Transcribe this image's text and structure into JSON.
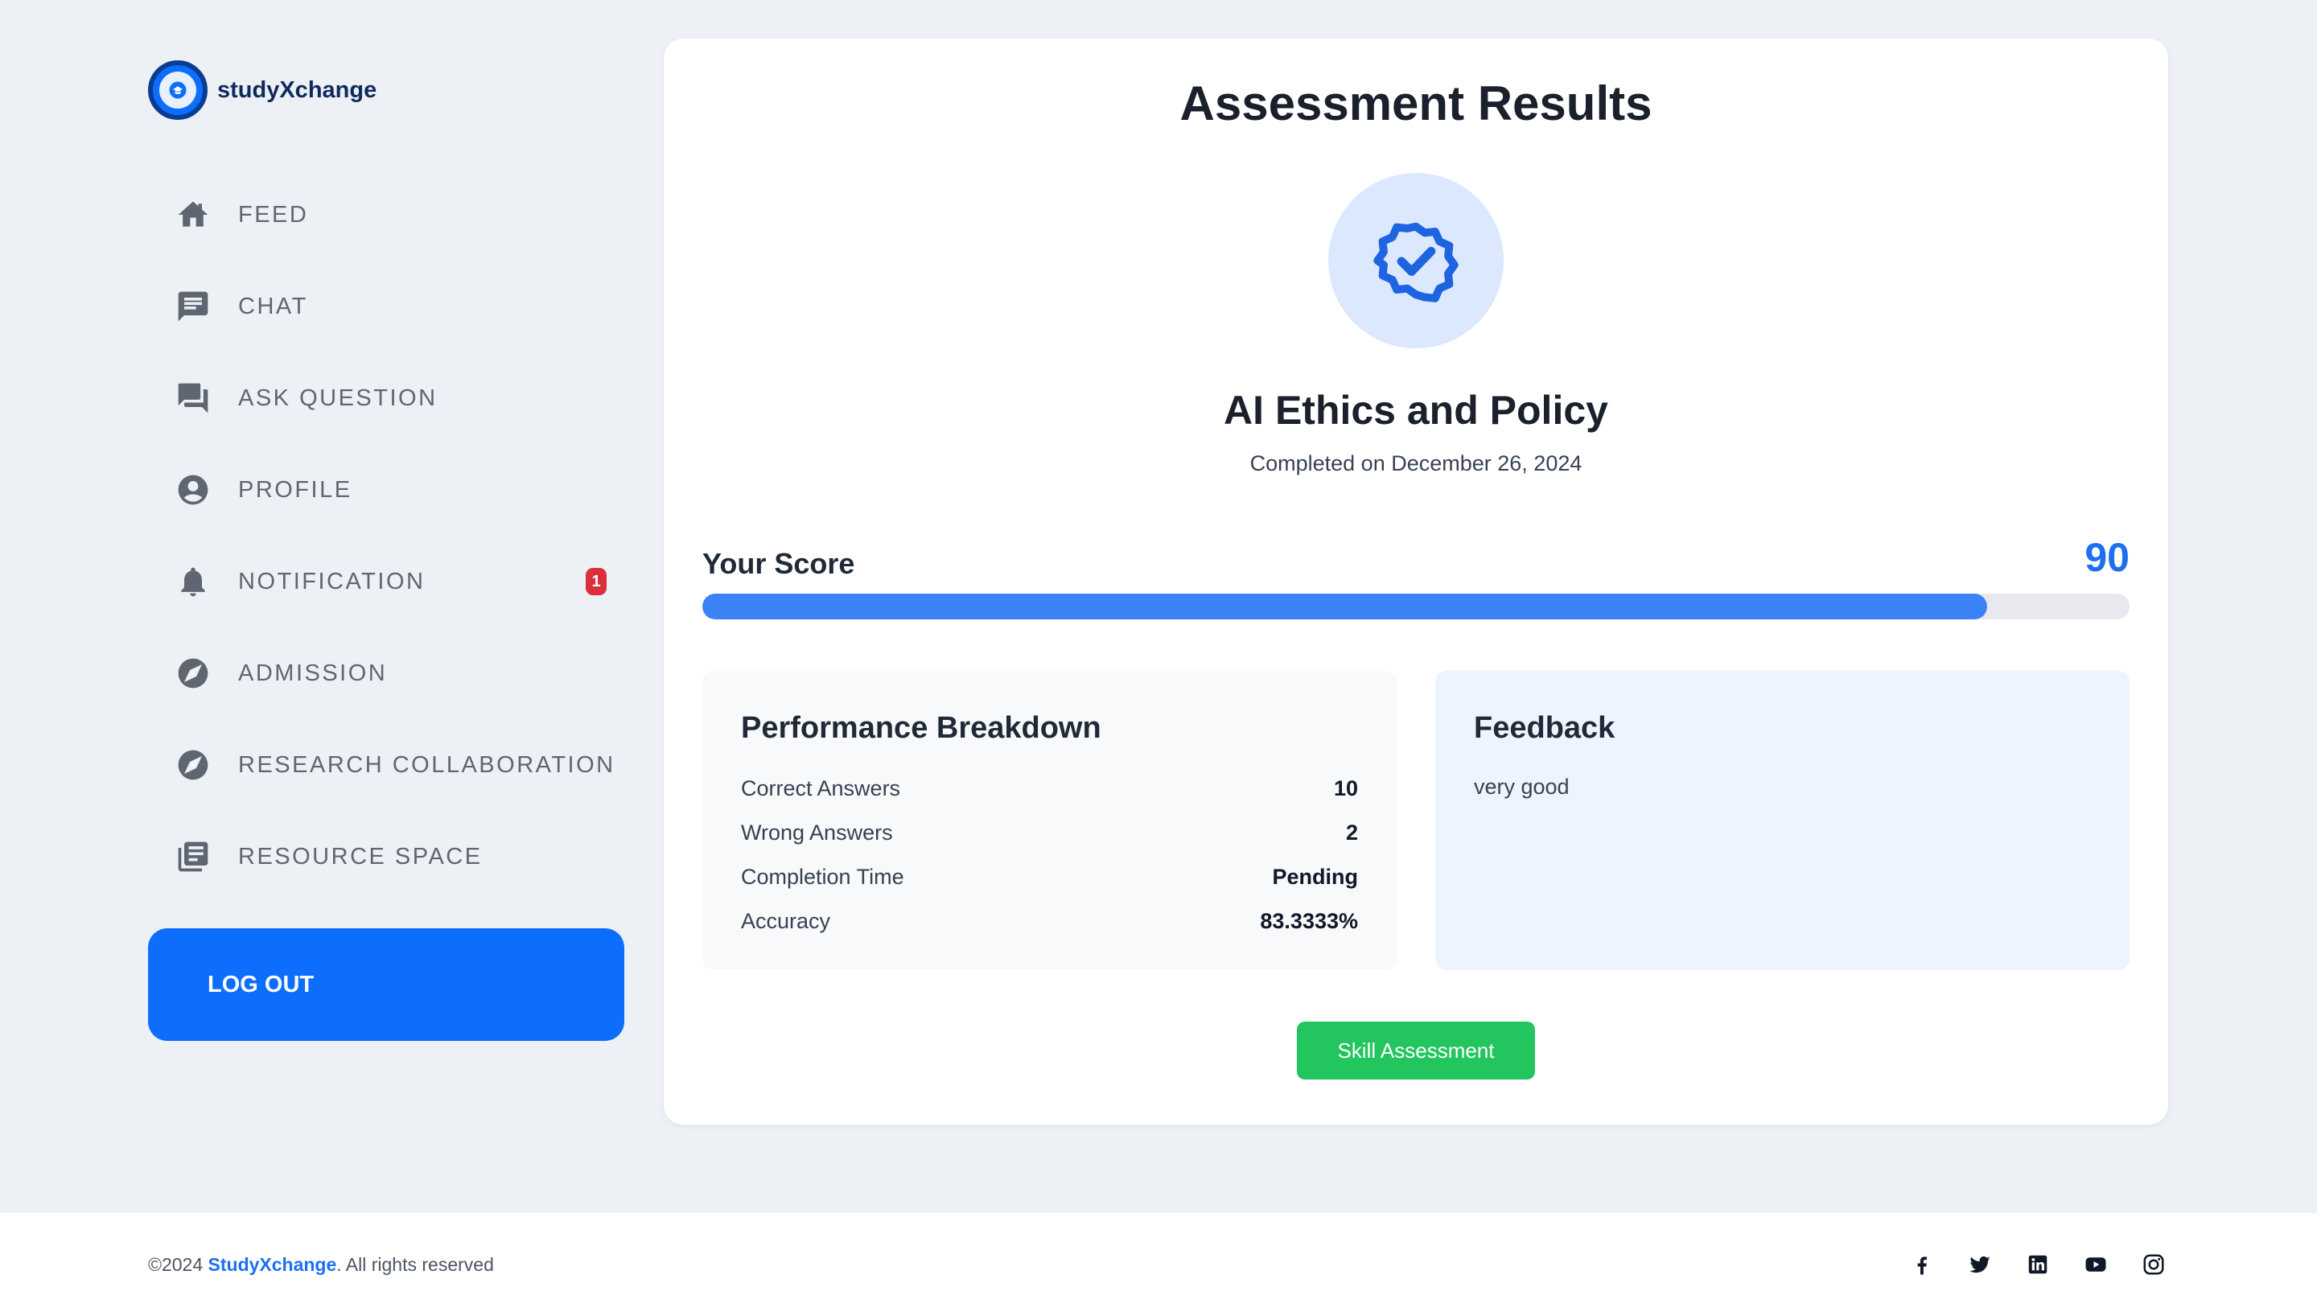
{
  "brand": {
    "name": "studyXchange"
  },
  "sidebar": {
    "items": [
      {
        "label": "FEED",
        "icon": "home-icon"
      },
      {
        "label": "CHAT",
        "icon": "chat-icon"
      },
      {
        "label": "ASK QUESTION",
        "icon": "forum-icon"
      },
      {
        "label": "PROFILE",
        "icon": "user-icon"
      },
      {
        "label": "NOTIFICATION",
        "icon": "bell-icon",
        "badge": "1"
      },
      {
        "label": "ADMISSION",
        "icon": "compass-icon"
      },
      {
        "label": "RESEARCH COLLABORATION",
        "icon": "compass-icon"
      },
      {
        "label": "RESOURCE SPACE",
        "icon": "library-icon"
      }
    ],
    "logout_label": "LOG OUT"
  },
  "main": {
    "title": "Assessment Results",
    "badge_icon": "verified-badge-icon",
    "assessment_name": "AI Ethics and Policy",
    "completed_text": "Completed on December 26, 2024",
    "score_label": "Your Score",
    "score_value": "90",
    "score_fraction": 0.9,
    "performance": {
      "title": "Performance Breakdown",
      "rows": [
        {
          "label": "Correct Answers",
          "value": "10"
        },
        {
          "label": "Wrong Answers",
          "value": "2"
        },
        {
          "label": "Completion Time",
          "value": "Pending"
        },
        {
          "label": "Accuracy",
          "value": "83.3333%"
        }
      ]
    },
    "feedback": {
      "title": "Feedback",
      "text": "very good"
    },
    "skill_button_label": "Skill Assessment"
  },
  "footer": {
    "copyright_prefix": "©2024 ",
    "copyright_brand": "StudyXchange",
    "copyright_suffix": ". All rights reserved",
    "socials": [
      "facebook-icon",
      "twitter-icon",
      "linkedin-icon",
      "youtube-icon",
      "instagram-icon"
    ]
  },
  "colors": {
    "primary": "#0d6efd",
    "score_blue": "#1e6ff0",
    "progress_fill": "#3b82f6",
    "success_green": "#22c55e",
    "badge_red": "#dc2f3c",
    "background": "#edf1f6"
  }
}
